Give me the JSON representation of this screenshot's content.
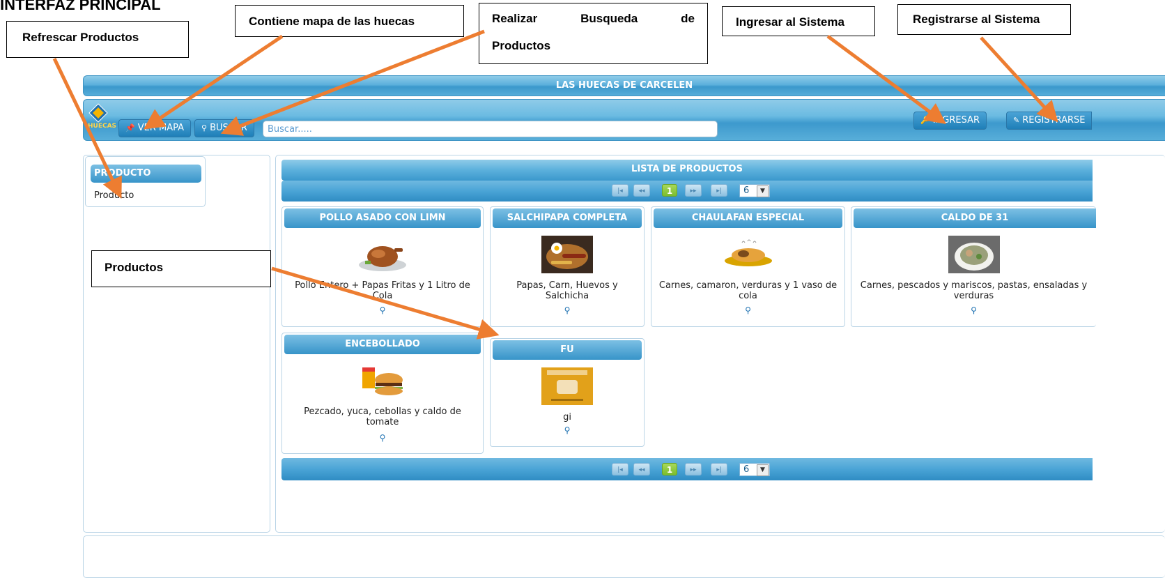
{
  "doc": {
    "title": "INTERFAZ PRINCIPAL",
    "callouts": {
      "refresh": "Refrescar Productos",
      "map": "Contiene mapa de las huecas",
      "search_a": "Realizar",
      "search_b": "Busqueda",
      "search_c": "de",
      "search_d": "Productos",
      "login": "Ingresar al Sistema",
      "register": "Registrarse al Sistema",
      "products": "Productos"
    },
    "arrow_color": "#ed7d31"
  },
  "app": {
    "title": "LAS HUECAS DE CARCELEN",
    "logo_text": "HUECAS",
    "toolbar": {
      "map_label": "VER MAPA",
      "search_label": "BUSCAR",
      "search_placeholder": "Buscar.....",
      "login_label": "INGRESAR",
      "register_label": "REGISTRARSE"
    },
    "sidebar": {
      "header": "PRODUCTO",
      "items": [
        "Producto"
      ]
    },
    "products": {
      "header": "LISTA DE PRODUCTOS",
      "pager": {
        "first": "⏮",
        "prev": "◀◀",
        "current": "1",
        "next": "▶▶",
        "last": "⏭",
        "per_page": "6"
      },
      "items": [
        {
          "name": "POLLO ASADO CON LIMN",
          "desc": "Pollo Entero + Papas Fritas y 1 Litro de Cola",
          "icon": "roast-chicken"
        },
        {
          "name": "SALCHIPAPA COMPLETA",
          "desc": "Papas, Carn, Huevos y Salchicha",
          "icon": "salchipapa"
        },
        {
          "name": "CHAULAFAN ESPECIAL",
          "desc": "Carnes, camaron, verduras y 1 vaso de cola",
          "icon": "rice-dish"
        },
        {
          "name": "CALDO DE 31",
          "desc": "Carnes, pescados y mariscos, pastas, ensaladas y verduras",
          "icon": "soup-bowl"
        },
        {
          "name": "ENCEBOLLADO",
          "desc": "Pezcado, yuca, cebollas y caldo de tomate",
          "icon": "fast-food"
        },
        {
          "name": "FU",
          "desc": "gi",
          "icon": "pandemonio-bread"
        }
      ]
    },
    "colors": {
      "accent": "#3794c9",
      "current_page": "#7cbd2d"
    }
  }
}
